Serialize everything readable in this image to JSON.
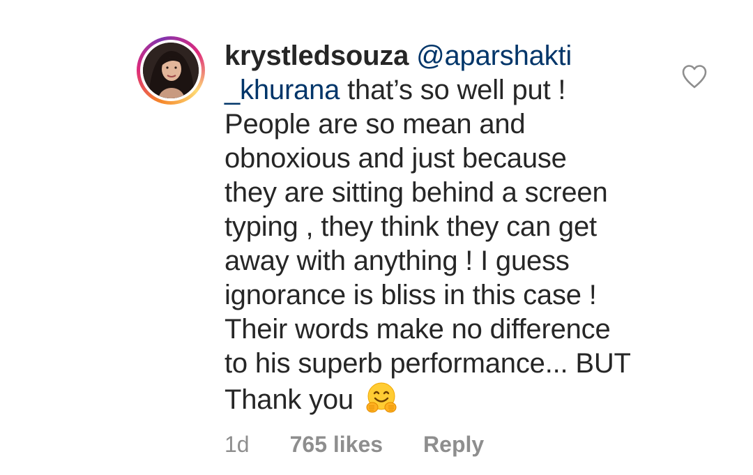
{
  "comment": {
    "username": "krystledsouza",
    "mention_part1": "@aparshakti",
    "mention_part2": "_khurana",
    "lines": [
      " that’s so well put !",
      "People are so mean and",
      "obnoxious and just because",
      "they are sitting behind a screen",
      "typing , they think they can get",
      "away with anything ! I guess",
      "ignorance is bliss in this case !",
      "Their words make no difference",
      "to his superb performance... BUT",
      "Thank you "
    ],
    "emoji_icon": "hugging-face-emoji",
    "time": "1d",
    "likes": "765 likes",
    "reply_label": "Reply",
    "like_icon": "heart-outline-icon"
  },
  "colors": {
    "text": "#262626",
    "mention": "#003569",
    "meta": "#8e8e8e",
    "ring_start": "#f58529",
    "ring_end": "#dd2a7b"
  }
}
